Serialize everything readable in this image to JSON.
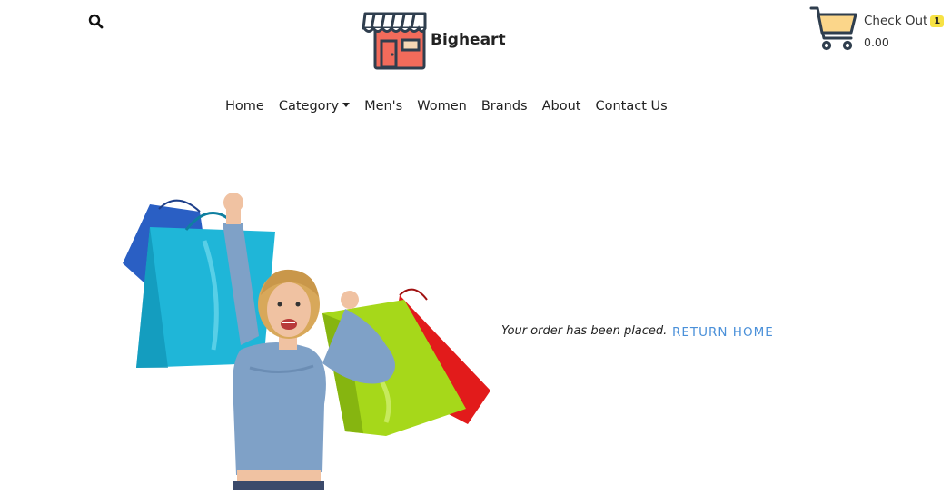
{
  "header": {
    "brand_name": "Bigheart",
    "cart": {
      "label": "Check Out",
      "count": "1",
      "total": "0.00"
    }
  },
  "nav": {
    "items": [
      {
        "id": "home",
        "label": "Home"
      },
      {
        "id": "category",
        "label": "Category",
        "has_dropdown": true
      },
      {
        "id": "mens",
        "label": "Men's"
      },
      {
        "id": "women",
        "label": "Women"
      },
      {
        "id": "brands",
        "label": "Brands"
      },
      {
        "id": "about",
        "label": "About"
      },
      {
        "id": "contact",
        "label": "Contact Us"
      }
    ]
  },
  "main": {
    "message": "Your order has been placed.",
    "return_label": "RETURN HOME"
  },
  "icons": {
    "search": "search-icon",
    "logo": "store-icon",
    "cart": "shopping-cart-icon",
    "dropdown": "caret-down-icon"
  },
  "colors": {
    "link_accent": "#4a90d9",
    "cart_badge": "#f7e244",
    "store_icon_body": "#f26b5b",
    "cart_basket": "#fbd68a"
  }
}
